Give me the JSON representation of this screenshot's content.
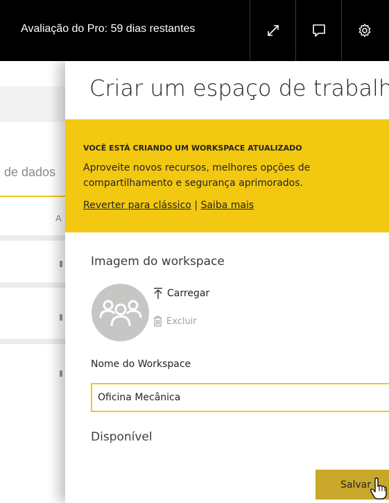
{
  "topbar": {
    "trial_text": "Avaliação do Pro: 59 dias restantes",
    "icons": [
      "expand-icon",
      "feedback-icon",
      "settings-icon"
    ]
  },
  "background": {
    "tab_text": "de dados",
    "column_text": "A"
  },
  "panel": {
    "title": "Criar um espaço de trabalho",
    "banner": {
      "heading": "VOCÊ ESTÁ CRIANDO UM WORKSPACE ATUALIZADO",
      "body": "Aproveite novos recursos, melhores opções de compartilhamento e segurança aprimorados.",
      "revert_link": "Reverter para clássico",
      "separator": "|",
      "learn_more_link": "Saiba mais"
    },
    "image_label": "Imagem do workspace",
    "upload_label": "Carregar",
    "delete_label": "Excluir",
    "name_label": "Nome do Workspace",
    "name_value": "Oficina Mecânica",
    "available_label": "Disponível",
    "save_label": "Salvar"
  },
  "colors": {
    "accent": "#f2c811",
    "topbar": "#000000",
    "save_button": "#c9a72a"
  }
}
